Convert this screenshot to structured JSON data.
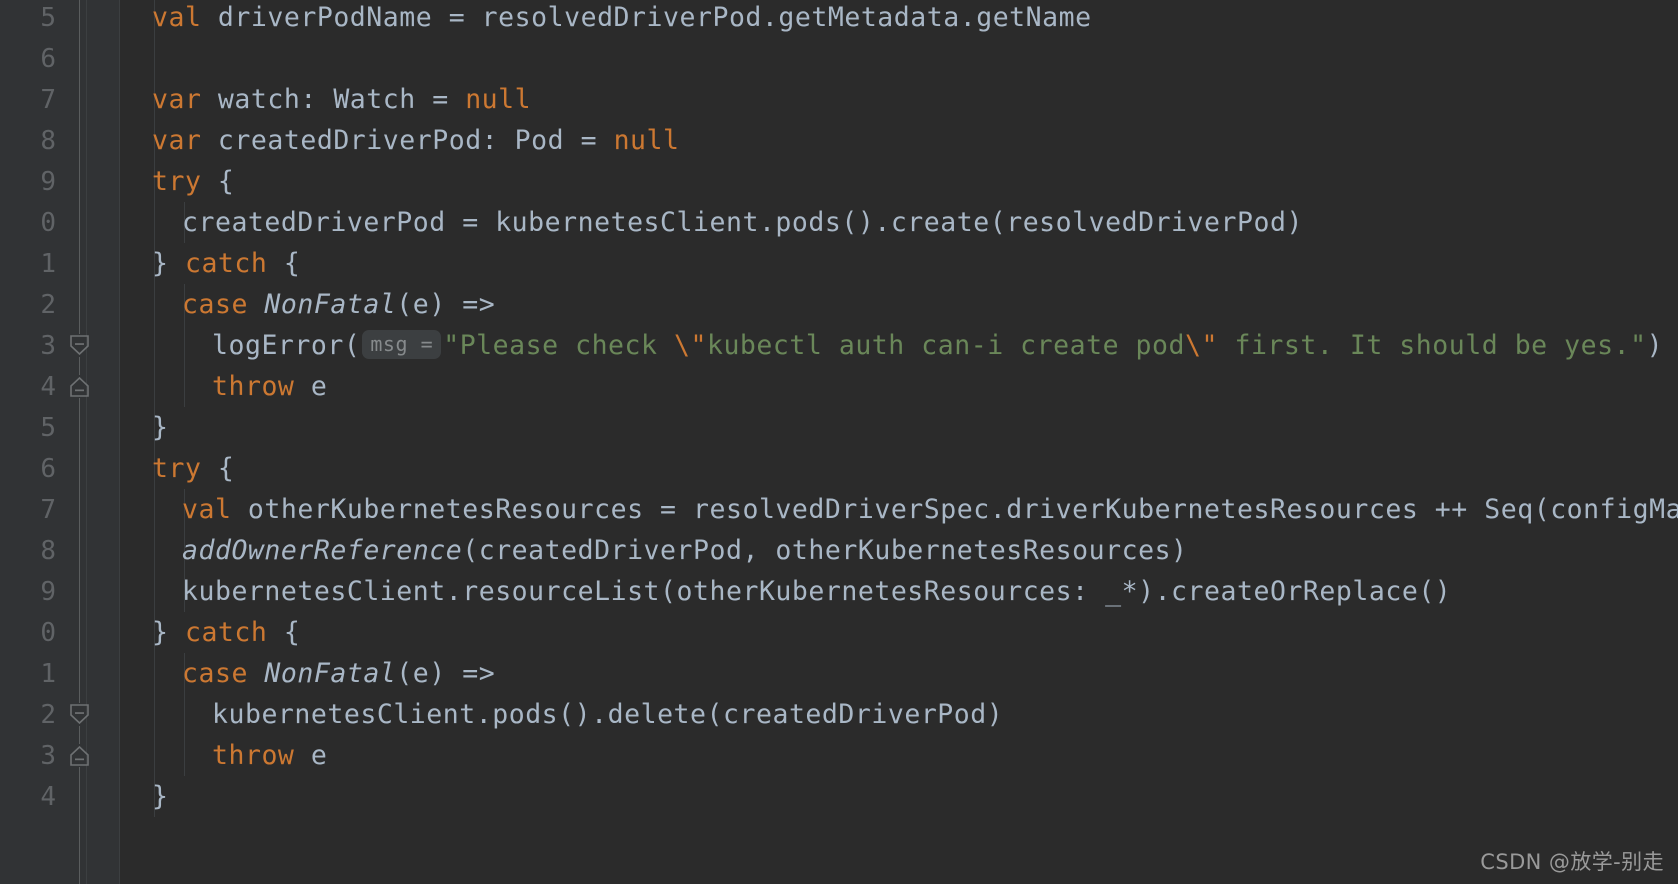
{
  "editor": {
    "language": "Scala",
    "theme": "darcula",
    "colors": {
      "background": "#2b2b2b",
      "gutter_background": "#313335",
      "line_number": "#606366",
      "identifier": "#a9b7c6",
      "keyword": "#cc7832",
      "string": "#6a8759",
      "hint_background": "#3c3f41",
      "hint_text": "#868a8c",
      "indent_guide": "#3b3e40",
      "watermark": "#9a9a9a"
    }
  },
  "gutter": {
    "line_numbers": [
      "5",
      "6",
      "7",
      "8",
      "9",
      "0",
      "1",
      "2",
      "3",
      "4",
      "5",
      "6",
      "7",
      "8",
      "9",
      "0",
      "1",
      "2",
      "3",
      "4"
    ],
    "fold_markers": [
      {
        "type": "fold-collapse-start-icon",
        "row": 8
      },
      {
        "type": "fold-collapse-end-icon",
        "row": 9
      },
      {
        "type": "fold-collapse-start-icon",
        "row": 17
      },
      {
        "type": "fold-collapse-end-icon",
        "row": 18
      }
    ]
  },
  "code": {
    "lines": [
      {
        "row": 0,
        "indent": 32,
        "tokens": [
          {
            "t": "val",
            "c": "kw"
          },
          {
            "t": " driverPodName = resolvedDriverPod.getMetadata.getName",
            "c": "id"
          }
        ]
      },
      {
        "row": 1,
        "indent": 32,
        "tokens": []
      },
      {
        "row": 2,
        "indent": 32,
        "tokens": [
          {
            "t": "var",
            "c": "kw"
          },
          {
            "t": " watch: Watch = ",
            "c": "id"
          },
          {
            "t": "null",
            "c": "kw"
          }
        ]
      },
      {
        "row": 3,
        "indent": 32,
        "tokens": [
          {
            "t": "var",
            "c": "kw"
          },
          {
            "t": " createdDriverPod: Pod = ",
            "c": "id"
          },
          {
            "t": "null",
            "c": "kw"
          }
        ]
      },
      {
        "row": 4,
        "indent": 32,
        "tokens": [
          {
            "t": "try",
            "c": "kw"
          },
          {
            "t": " {",
            "c": "id"
          }
        ]
      },
      {
        "row": 5,
        "indent": 62,
        "tokens": [
          {
            "t": "createdDriverPod = kubernetesClient.pods().create(resolvedDriverPod)",
            "c": "id"
          }
        ]
      },
      {
        "row": 6,
        "indent": 32,
        "tokens": [
          {
            "t": "} ",
            "c": "id"
          },
          {
            "t": "catch",
            "c": "kw"
          },
          {
            "t": " {",
            "c": "id"
          }
        ]
      },
      {
        "row": 7,
        "indent": 62,
        "tokens": [
          {
            "t": "case",
            "c": "kw"
          },
          {
            "t": " ",
            "c": "id"
          },
          {
            "t": "NonFatal",
            "c": "ital"
          },
          {
            "t": "(e) =>",
            "c": "id"
          }
        ]
      },
      {
        "row": 8,
        "indent": 92,
        "tokens": [
          {
            "t": "logError(",
            "c": "id"
          },
          {
            "t": "msg =",
            "c": "hint"
          },
          {
            "t": "\"Please check ",
            "c": "str"
          },
          {
            "t": "\\\"",
            "c": "esc"
          },
          {
            "t": "kubectl auth can-i create pod",
            "c": "str"
          },
          {
            "t": "\\\"",
            "c": "esc"
          },
          {
            "t": " first. It should be yes.\"",
            "c": "str"
          },
          {
            "t": ")",
            "c": "id"
          }
        ]
      },
      {
        "row": 9,
        "indent": 92,
        "tokens": [
          {
            "t": "throw",
            "c": "kw"
          },
          {
            "t": " e",
            "c": "id"
          }
        ]
      },
      {
        "row": 10,
        "indent": 32,
        "tokens": [
          {
            "t": "}",
            "c": "id"
          }
        ]
      },
      {
        "row": 11,
        "indent": 32,
        "tokens": [
          {
            "t": "try",
            "c": "kw"
          },
          {
            "t": " {",
            "c": "id"
          }
        ]
      },
      {
        "row": 12,
        "indent": 62,
        "tokens": [
          {
            "t": "val",
            "c": "kw"
          },
          {
            "t": " otherKubernetesResources = resolvedDriverSpec.driverKubernetesResources ++ Seq(configMap)",
            "c": "id"
          }
        ]
      },
      {
        "row": 13,
        "indent": 62,
        "tokens": [
          {
            "t": "addOwnerReference",
            "c": "ital"
          },
          {
            "t": "(createdDriverPod, otherKubernetesResources)",
            "c": "id"
          }
        ]
      },
      {
        "row": 14,
        "indent": 62,
        "tokens": [
          {
            "t": "kubernetesClient.resourceList(otherKubernetesResources: _*).createOrReplace()",
            "c": "id"
          }
        ]
      },
      {
        "row": 15,
        "indent": 32,
        "tokens": [
          {
            "t": "} ",
            "c": "id"
          },
          {
            "t": "catch",
            "c": "kw"
          },
          {
            "t": " {",
            "c": "id"
          }
        ]
      },
      {
        "row": 16,
        "indent": 62,
        "tokens": [
          {
            "t": "case",
            "c": "kw"
          },
          {
            "t": " ",
            "c": "id"
          },
          {
            "t": "NonFatal",
            "c": "ital"
          },
          {
            "t": "(e) =>",
            "c": "id"
          }
        ]
      },
      {
        "row": 17,
        "indent": 92,
        "tokens": [
          {
            "t": "kubernetesClient.pods().delete(createdDriverPod)",
            "c": "id"
          }
        ]
      },
      {
        "row": 18,
        "indent": 92,
        "tokens": [
          {
            "t": "throw",
            "c": "kw"
          },
          {
            "t": " e",
            "c": "id"
          }
        ]
      },
      {
        "row": 19,
        "indent": 32,
        "tokens": [
          {
            "t": "}",
            "c": "id"
          }
        ]
      }
    ],
    "indent_guides": [
      {
        "x": 34,
        "row_start": 0,
        "row_end": 20
      },
      {
        "x": 64,
        "row_start": 5,
        "row_end": 6
      },
      {
        "x": 64,
        "row_start": 7,
        "row_end": 10
      },
      {
        "x": 64,
        "row_start": 12,
        "row_end": 15
      },
      {
        "x": 64,
        "row_start": 16,
        "row_end": 19
      }
    ]
  },
  "watermark": {
    "text": "CSDN @放学-别走"
  }
}
